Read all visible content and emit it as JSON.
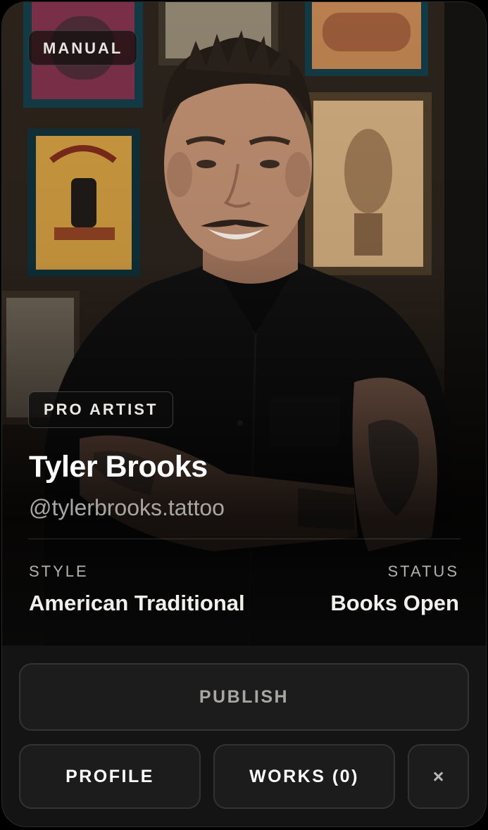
{
  "card": {
    "badge_top": "MANUAL",
    "photo_alt": "Portrait of tattoo artist in a studio with framed flash art",
    "badge_tier": "PRO ARTIST",
    "name": "Tyler Brooks",
    "handle": "@tylerbrooks.tattoo",
    "style": {
      "label": "STYLE",
      "value": "American Traditional"
    },
    "status": {
      "label": "STATUS",
      "value": "Books Open"
    }
  },
  "actions": {
    "publish_label": "PUBLISH",
    "profile_label": "PROFILE",
    "works_label": "WORKS (0)",
    "close_icon": "close-icon",
    "close_glyph": "×"
  },
  "colors": {
    "card_background": "#141414",
    "button_background": "#1c1c1c",
    "button_border": "#333333",
    "text_primary": "#ffffff",
    "text_muted": "#a8a6a4"
  }
}
